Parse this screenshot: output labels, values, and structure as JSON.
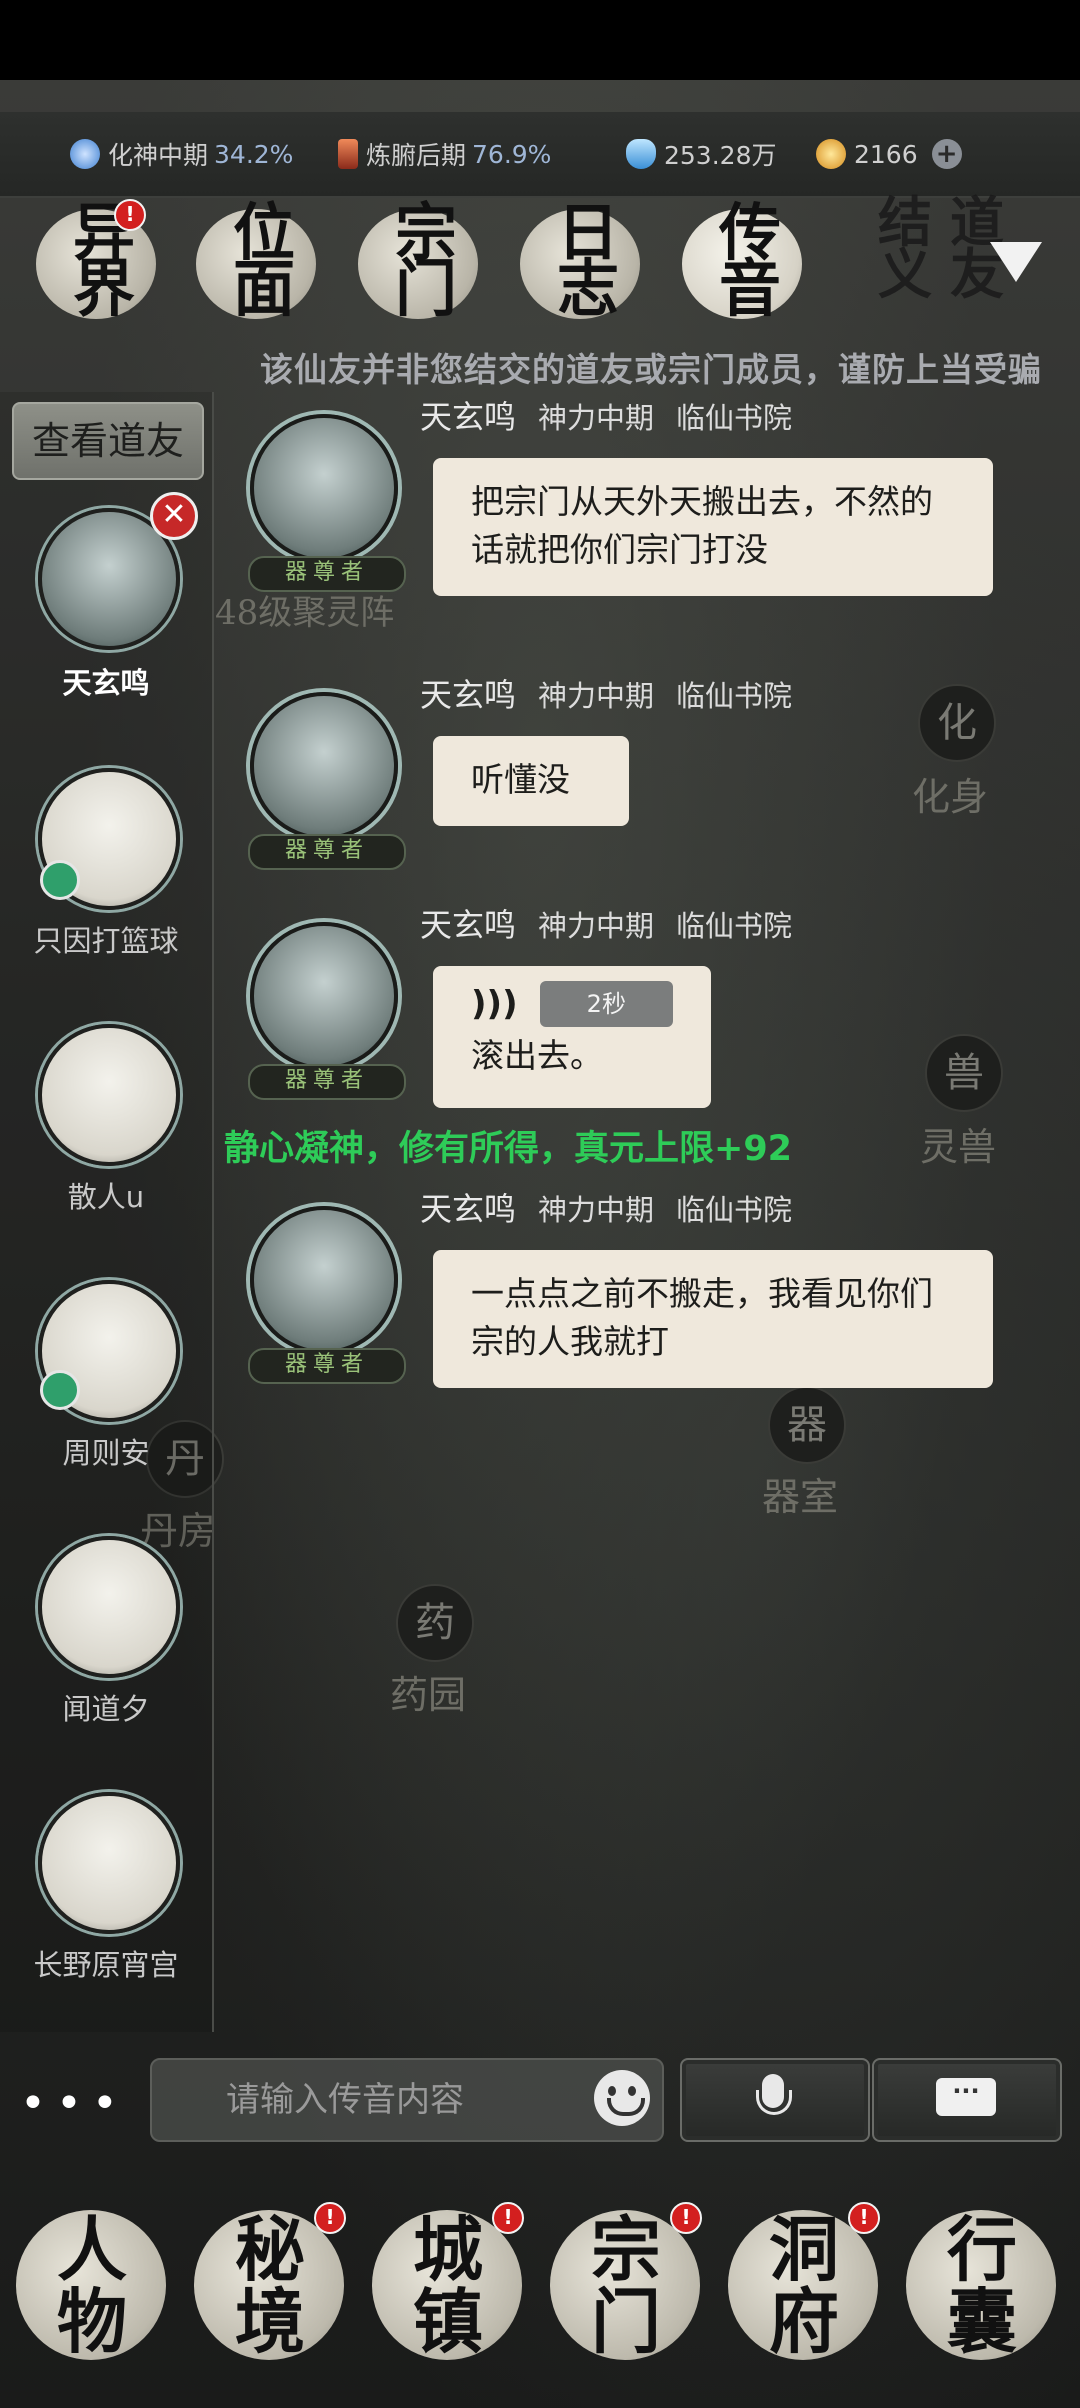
{
  "status_bar": {
    "realm_primary": {
      "label": "化神中期",
      "percent": "34.2%"
    },
    "realm_body": {
      "label": "炼腑后期",
      "percent": "76.9%"
    },
    "spirit_stones": "253.28万",
    "jade": "2166"
  },
  "top_tabs": [
    {
      "label": "异\n界",
      "has_alert": true
    },
    {
      "label": "位\n面",
      "has_alert": false
    },
    {
      "label": "宗\n门",
      "has_alert": false
    },
    {
      "label": "日\n志",
      "has_alert": false
    },
    {
      "label": "传\n音",
      "has_alert": false
    }
  ],
  "top_right": {
    "label": "结道\n义友"
  },
  "warning_text": "该仙友并非您结交的道友或宗门成员，谨防上当受骗",
  "view_friends_label": "查看道友",
  "friends": [
    {
      "name": "天玄鸣",
      "selected": true,
      "removable": true,
      "online": false
    },
    {
      "name": "只因打篮球",
      "selected": false,
      "online": true
    },
    {
      "name": "散人u",
      "selected": false,
      "online": false
    },
    {
      "name": "周则安",
      "selected": false,
      "online": true
    },
    {
      "name": "闻道夕",
      "selected": false,
      "online": false
    },
    {
      "name": "长野原宵宫",
      "selected": false,
      "online": false
    }
  ],
  "messages": [
    {
      "sender": "天玄鸣",
      "realm": "神力中期",
      "sect": "临仙书院",
      "title": "器尊者",
      "text": "把宗门从天外天搬出去，不然的话就把你们宗门打没"
    },
    {
      "sender": "天玄鸣",
      "realm": "神力中期",
      "sect": "临仙书院",
      "title": "器尊者",
      "text": "听懂没"
    },
    {
      "sender": "天玄鸣",
      "realm": "神力中期",
      "sect": "临仙书院",
      "title": "器尊者",
      "voice_duration": "2秒",
      "text": "滚出去。"
    },
    {
      "sender": "天玄鸣",
      "realm": "神力中期",
      "sect": "临仙书院",
      "title": "器尊者",
      "text": "一点点之前不搬走，我看见你们宗的人我就打"
    }
  ],
  "system_message": "静心凝神，修有所得，真元上限+92",
  "background_labels": {
    "array": "48级聚灵阵",
    "huashen": {
      "glyph": "化",
      "label": "化身"
    },
    "lingshou": {
      "glyph": "兽",
      "label": "灵兽"
    },
    "qishi": {
      "glyph": "器",
      "label": "器室"
    },
    "danfang": {
      "glyph": "丹",
      "label": "丹房"
    },
    "yaoyuan": {
      "glyph": "药",
      "label": "药园"
    }
  },
  "input": {
    "placeholder": "请输入传音内容",
    "more_label": "•••"
  },
  "bottom_nav": [
    {
      "label": "人\n物",
      "has_alert": false
    },
    {
      "label": "秘\n境",
      "has_alert": true
    },
    {
      "label": "城\n镇",
      "has_alert": true
    },
    {
      "label": "宗\n门",
      "has_alert": true
    },
    {
      "label": "洞\n府",
      "has_alert": true
    },
    {
      "label": "行\n囊",
      "has_alert": false
    }
  ],
  "colors": {
    "accent_green": "#2ecc58",
    "bubble": "#efe8dc",
    "alert_red": "#d31f1f"
  }
}
